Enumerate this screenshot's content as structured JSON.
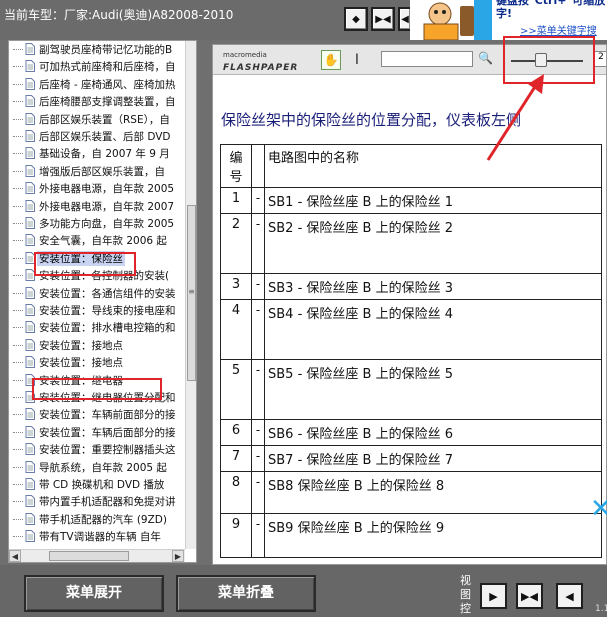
{
  "vehicle_label": "当前车型：厂家:Audi(奥迪)A82008-2010",
  "banner": {
    "text": "键盘按\"Ctrl+\"可缩放字!",
    "link": ">>菜单关键字搜"
  },
  "tree": {
    "items": [
      "副驾驶员座椅带记忆功能的B",
      "可加热式前座椅和后座椅，自",
      "后座椅 - 座椅通风、座椅加热",
      "后座椅腰部支撑调整装置，自",
      "后部区娱乐装置（RSE），自",
      "后部区娱乐装置、后部 DVD",
      "基础设备，自 2007 年 9 月",
      "增强版后部区娱乐装置，自",
      "外接电器电源，自年款 2005",
      "外接电器电源，自年款 2007",
      "多功能方向盘，自年款 2005",
      "安全气囊，自年款 2006 起",
      "安装位置：保险丝",
      "安装位置：各控制器的安装(",
      "安装位置：各通信组件的安装",
      "安装位置：导线束的接电座和",
      "安装位置：排水槽电控箱的和",
      "安装位置：接地点",
      "安装位置：接地点",
      "安装位置：继电器",
      "安装位置：继电器位置分配和",
      "安装位置：车辆前面部分的接",
      "安装位置：车辆后面部分的接",
      "安装位置：重要控制器插头这",
      "导航系统，自年款 2005 起",
      "带 CD 换碟机和 DVD 播放",
      "带内置手机适配器和免提对讲",
      "带手机适配器的汽车 (9ZD)",
      "带有TV调谐器的车辆 自年"
    ],
    "selected_index": 12,
    "scroll_arrows": {
      "left": "◀",
      "right": "▶",
      "grip": "≡"
    }
  },
  "toolbar": {
    "btn1": "◆",
    "btn2": "▶◀",
    "btn3": "◀"
  },
  "viewer": {
    "logo_small": "macromedia",
    "logo_big": "FLASHPAPER",
    "search_value": "",
    "page_indicator": "2",
    "zoom_level": 0.36
  },
  "document": {
    "title": "保险丝架中的保险丝的位置分配，仪表板左侧",
    "table": {
      "headers": [
        "编号",
        "",
        "电路图中的名称"
      ],
      "rows": [
        {
          "num": "1",
          "sep": "-",
          "name": "SB1 - 保险丝座 B 上的保险丝 1"
        },
        {
          "num": "2",
          "sep": "-",
          "name": "SB2 - 保险丝座 B 上的保险丝 2"
        },
        {
          "num": "3",
          "sep": "-",
          "name": "SB3 - 保险丝座 B 上的保险丝 3"
        },
        {
          "num": "4",
          "sep": "-",
          "name": "SB4 - 保险丝座 B 上的保险丝 4"
        },
        {
          "num": "5",
          "sep": "-",
          "name": "SB5 - 保险丝座 B 上的保险丝 5"
        },
        {
          "num": "6",
          "sep": "-",
          "name": "SB6 - 保险丝座 B 上的保险丝 6"
        },
        {
          "num": "7",
          "sep": "-",
          "name": "SB7 - 保险丝座 B 上的保险丝 7"
        },
        {
          "num": "8",
          "sep": "-",
          "name": "SB8 保险丝座 B 上的保险丝 8"
        },
        {
          "num": "9",
          "sep": "-",
          "name": "SB9 保险丝座 B 上的保险丝 9"
        }
      ]
    }
  },
  "bottom": {
    "expand_label": "菜单展开",
    "collapse_label": "菜单折叠",
    "view_label": "视图控",
    "btn1": "▶",
    "btn2": "▶◀",
    "btn3": "◀",
    "version": "1.1"
  },
  "colors": {
    "annotation_red": "#e0252a",
    "title_blue": "#1a1f78"
  }
}
